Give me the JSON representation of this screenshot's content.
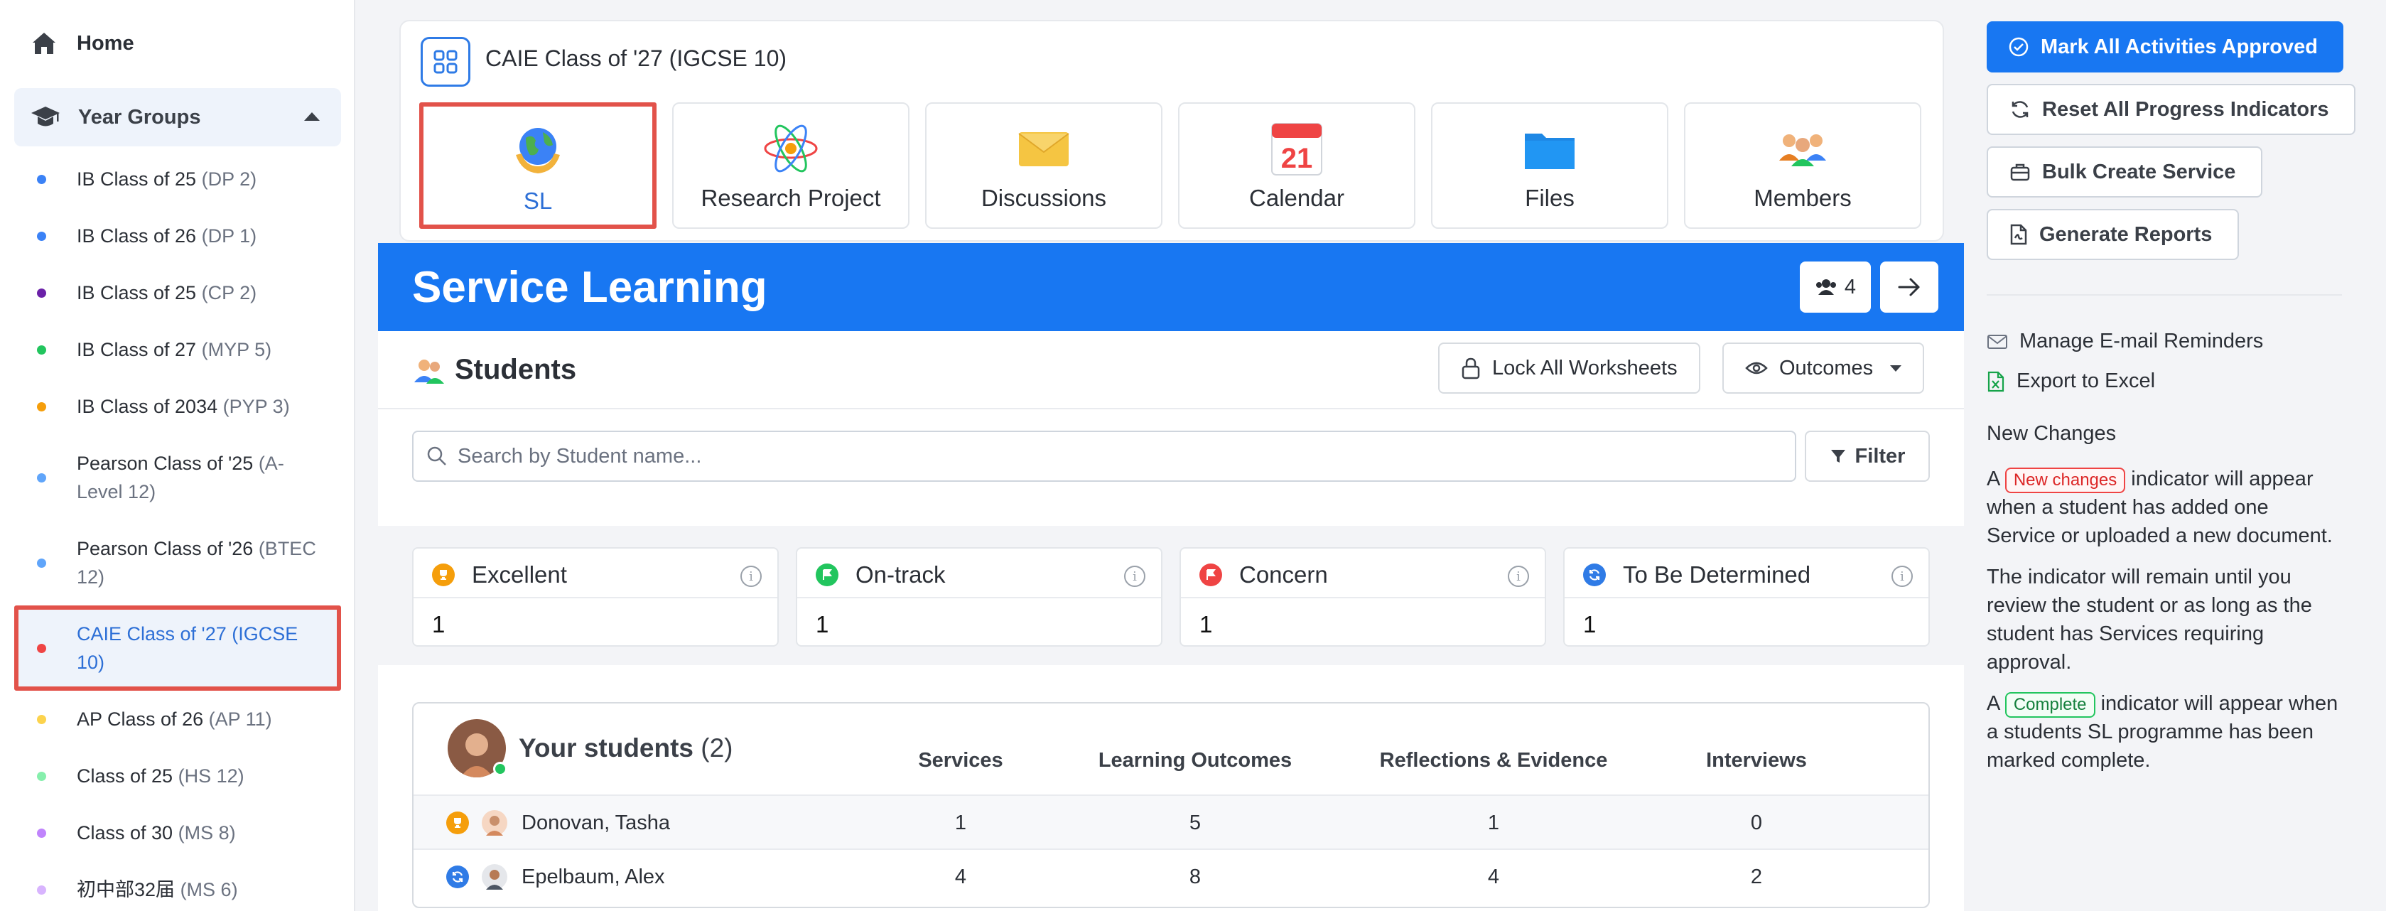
{
  "sidebar": {
    "home": "Home",
    "year_groups": "Year Groups",
    "groups": [
      {
        "name": "IB Class of 25",
        "sub": "(DP 2)",
        "color": "#3b82f6"
      },
      {
        "name": "IB Class of 26",
        "sub": "(DP 1)",
        "color": "#3b82f6"
      },
      {
        "name": "IB Class of 25",
        "sub": "(CP 2)",
        "color": "#6b21a8"
      },
      {
        "name": "IB Class of 27",
        "sub": "(MYP 5)",
        "color": "#22c55e"
      },
      {
        "name": "IB Class of 2034",
        "sub": "(PYP 3)",
        "color": "#f59e0b"
      },
      {
        "name": "Pearson Class of '25",
        "sub": "(A-Level 12)",
        "color": "#60a5fa"
      },
      {
        "name": "Pearson Class of '26",
        "sub": "(BTEC 12)",
        "color": "#60a5fa"
      },
      {
        "name": "CAIE Class of '27",
        "sub": "(IGCSE 10)",
        "color": "#ef4444"
      },
      {
        "name": "AP Class of 26",
        "sub": "(AP 11)",
        "color": "#fcd34d"
      },
      {
        "name": "Class of 25",
        "sub": "(HS 12)",
        "color": "#86efac"
      },
      {
        "name": "Class of 30",
        "sub": "(MS 8)",
        "color": "#c084fc"
      },
      {
        "name": "初中部32届",
        "sub": "(MS 6)",
        "color": "#d8b4fe"
      }
    ]
  },
  "header": {
    "class_title": "CAIE Class of '27 (IGCSE 10)",
    "tiles": [
      {
        "label": "SL",
        "icon": "globe-hands-icon"
      },
      {
        "label": "Research Project",
        "icon": "atom-icon"
      },
      {
        "label": "Discussions",
        "icon": "envelope-icon"
      },
      {
        "label": "Calendar",
        "icon": "calendar-icon",
        "day": "21"
      },
      {
        "label": "Files",
        "icon": "folder-icon"
      },
      {
        "label": "Members",
        "icon": "people-icon"
      }
    ]
  },
  "banner": {
    "title": "Service Learning",
    "members_count": "4"
  },
  "students_section": {
    "title": "Students",
    "lock_label": "Lock All Worksheets",
    "outcomes_label": "Outcomes",
    "search_placeholder": "Search by Student name...",
    "filter_label": "Filter"
  },
  "stats": [
    {
      "label": "Excellent",
      "value": "1",
      "color": "#f59e0b"
    },
    {
      "label": "On-track",
      "value": "1",
      "color": "#22c55e"
    },
    {
      "label": "Concern",
      "value": "1",
      "color": "#ef4444"
    },
    {
      "label": "To Be Determined",
      "value": "1",
      "color": "#2f7be6"
    }
  ],
  "your_students": {
    "title": "Your students",
    "count": "(2)",
    "columns": [
      "Services",
      "Learning Outcomes",
      "Reflections & Evidence",
      "Interviews"
    ],
    "rows": [
      {
        "name": "Donovan, Tasha",
        "status": "excellent",
        "values": [
          "1",
          "5",
          "1",
          "0"
        ]
      },
      {
        "name": "Epelbaum, Alex",
        "status": "tbd",
        "values": [
          "4",
          "8",
          "4",
          "2"
        ]
      }
    ]
  },
  "actions": {
    "approve": "Mark All Activities Approved",
    "reset": "Reset All Progress Indicators",
    "bulk": "Bulk Create Service",
    "reports": "Generate Reports",
    "reminders": "Manage E-mail Reminders",
    "export": "Export to Excel"
  },
  "new_changes": {
    "title": "New Changes",
    "p1_pre": "A",
    "p1_chip": "New changes",
    "p1_post": "indicator will appear when a student has added one Service or uploaded a new document.",
    "p2": "The indicator will remain until you review the student or as long as the student has Services requiring approval.",
    "p3_pre": "A",
    "p3_chip": "Complete",
    "p3_post": "indicator will appear when a students SL programme has been marked complete."
  }
}
